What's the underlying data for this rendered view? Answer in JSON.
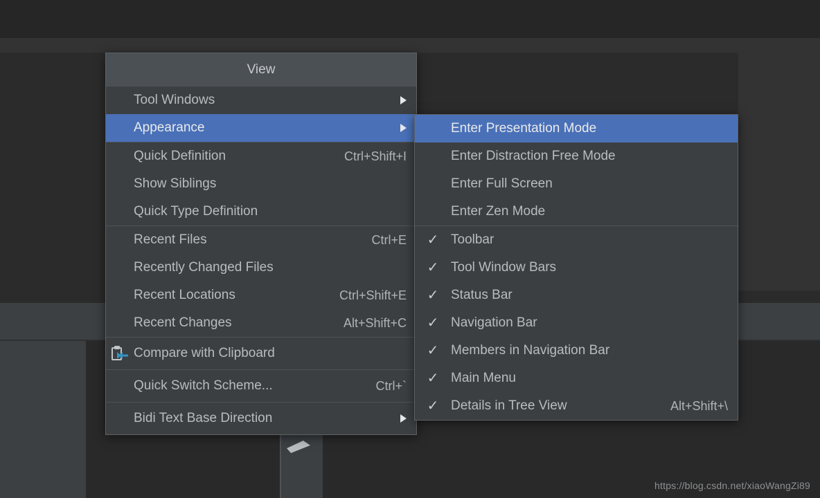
{
  "colors": {
    "menu_background": "#3c3f41",
    "menu_border": "#5e6164",
    "menu_header_background": "#4b5054",
    "highlight": "#4a71b8",
    "text": "#b9bcbe",
    "separator": "#4f5356",
    "icon_accent": "#3592c4",
    "editor_background": "#2b2b2b",
    "panel_background": "#3c4043"
  },
  "watermark": {
    "text": "https://blog.csdn.net/xiaoWangZi89"
  },
  "view_menu": {
    "title": "View",
    "groups": [
      {
        "items": [
          {
            "label": "Tool Windows",
            "shortcut": "",
            "submenu": true,
            "selected": false,
            "icon": "",
            "checked": false
          },
          {
            "label": "Appearance",
            "shortcut": "",
            "submenu": true,
            "selected": true,
            "icon": "",
            "checked": false
          }
        ]
      },
      {
        "items": [
          {
            "label": "Quick Definition",
            "shortcut": "Ctrl+Shift+I",
            "submenu": false,
            "selected": false,
            "icon": "",
            "checked": false
          },
          {
            "label": "Show Siblings",
            "shortcut": "",
            "submenu": false,
            "selected": false,
            "icon": "",
            "checked": false
          },
          {
            "label": "Quick Type Definition",
            "shortcut": "",
            "submenu": false,
            "selected": false,
            "icon": "",
            "checked": false
          }
        ]
      },
      {
        "items": [
          {
            "label": "Recent Files",
            "shortcut": "Ctrl+E",
            "submenu": false,
            "selected": false,
            "icon": "",
            "checked": false
          },
          {
            "label": "Recently Changed Files",
            "shortcut": "",
            "submenu": false,
            "selected": false,
            "icon": "",
            "checked": false
          },
          {
            "label": "Recent Locations",
            "shortcut": "Ctrl+Shift+E",
            "submenu": false,
            "selected": false,
            "icon": "",
            "checked": false
          },
          {
            "label": "Recent Changes",
            "shortcut": "Alt+Shift+C",
            "submenu": false,
            "selected": false,
            "icon": "",
            "checked": false
          }
        ]
      },
      {
        "items": [
          {
            "label": "Compare with Clipboard",
            "shortcut": "",
            "submenu": false,
            "selected": false,
            "icon": "compare-clipboard-icon",
            "checked": false
          }
        ]
      },
      {
        "items": [
          {
            "label": "Quick Switch Scheme...",
            "shortcut": "Ctrl+`",
            "submenu": false,
            "selected": false,
            "icon": "",
            "checked": false
          }
        ]
      },
      {
        "items": [
          {
            "label": "Bidi Text Base Direction",
            "shortcut": "",
            "submenu": true,
            "selected": false,
            "icon": "",
            "checked": false
          }
        ]
      }
    ]
  },
  "appearance_menu": {
    "groups": [
      {
        "items": [
          {
            "label": "Enter Presentation Mode",
            "shortcut": "",
            "submenu": false,
            "selected": true,
            "checked": false
          },
          {
            "label": "Enter Distraction Free Mode",
            "shortcut": "",
            "submenu": false,
            "selected": false,
            "checked": false
          },
          {
            "label": "Enter Full Screen",
            "shortcut": "",
            "submenu": false,
            "selected": false,
            "checked": false
          },
          {
            "label": "Enter Zen Mode",
            "shortcut": "",
            "submenu": false,
            "selected": false,
            "checked": false
          }
        ]
      },
      {
        "items": [
          {
            "label": "Toolbar",
            "shortcut": "",
            "submenu": false,
            "selected": false,
            "checked": true
          },
          {
            "label": "Tool Window Bars",
            "shortcut": "",
            "submenu": false,
            "selected": false,
            "checked": true
          },
          {
            "label": "Status Bar",
            "shortcut": "",
            "submenu": false,
            "selected": false,
            "checked": true
          },
          {
            "label": "Navigation Bar",
            "shortcut": "",
            "submenu": false,
            "selected": false,
            "checked": true
          },
          {
            "label": "Members in Navigation Bar",
            "shortcut": "",
            "submenu": false,
            "selected": false,
            "checked": true
          },
          {
            "label": "Main Menu",
            "shortcut": "",
            "submenu": false,
            "selected": false,
            "checked": true
          },
          {
            "label": "Details in Tree View",
            "shortcut": "Alt+Shift+\\",
            "submenu": false,
            "selected": false,
            "checked": true
          }
        ]
      }
    ]
  },
  "icons": {
    "check_glyph": "✓"
  }
}
